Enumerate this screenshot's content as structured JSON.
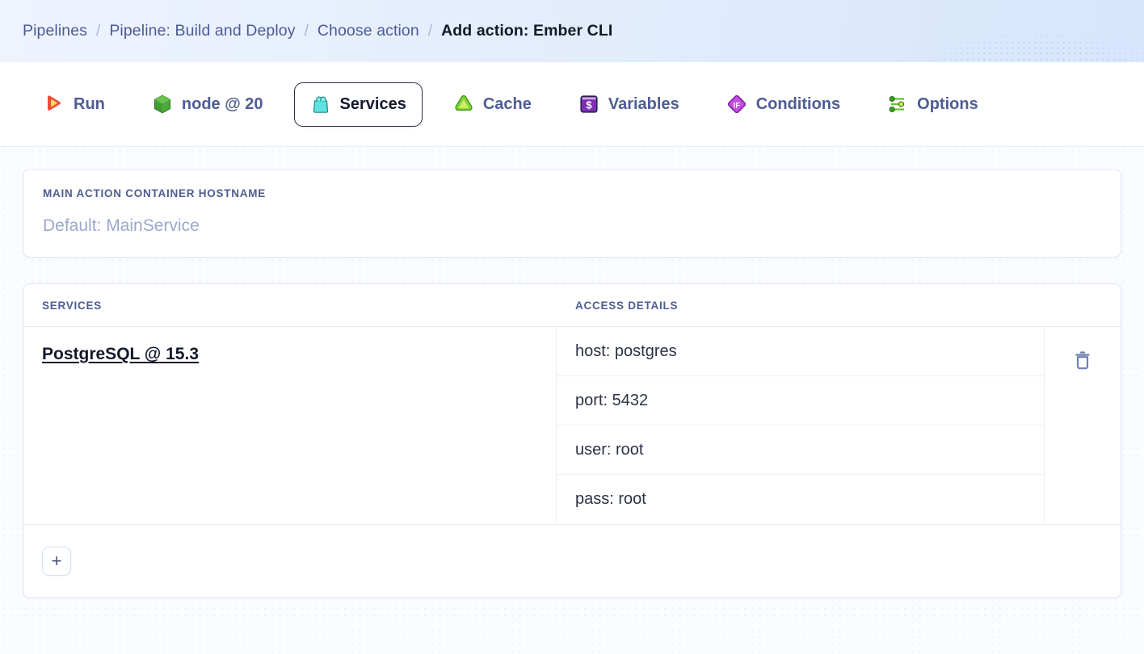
{
  "breadcrumb": {
    "separator": "/",
    "items": [
      {
        "label": "Pipelines",
        "current": false
      },
      {
        "label": "Pipeline: Build and Deploy",
        "current": false
      },
      {
        "label": "Choose action",
        "current": false
      },
      {
        "label": "Add action: Ember CLI",
        "current": true
      }
    ]
  },
  "tabs": [
    {
      "label": "Run",
      "icon": "play-icon",
      "selected": false
    },
    {
      "label": "node @ 20",
      "icon": "node-cube-icon",
      "selected": false
    },
    {
      "label": "Services",
      "icon": "services-icon",
      "selected": true
    },
    {
      "label": "Cache",
      "icon": "cache-icon",
      "selected": false
    },
    {
      "label": "Variables",
      "icon": "variables-icon",
      "selected": false
    },
    {
      "label": "Conditions",
      "icon": "conditions-icon",
      "selected": false
    },
    {
      "label": "Options",
      "icon": "options-icon",
      "selected": false
    }
  ],
  "hostname_card": {
    "label": "MAIN ACTION CONTAINER HOSTNAME",
    "value": "",
    "placeholder": "Default: MainService"
  },
  "services_table": {
    "headers": {
      "services": "SERVICES",
      "access_details": "ACCESS DETAILS"
    },
    "rows": [
      {
        "service": "PostgreSQL @ 15.3",
        "details": [
          "host: postgres",
          "port: 5432",
          "user: root",
          "pass: root"
        ],
        "delete_icon": "trash-icon"
      }
    ],
    "add_button_label": "+"
  },
  "colors": {
    "header_gradient_start": "#eef3fe",
    "header_gradient_end": "#d6e6fc",
    "crumb_link": "#4b5c97",
    "crumb_current": "#14182b",
    "tab_label": "#4e5d93",
    "tab_selected_border": "#2c3347",
    "card_border": "#dde5f4",
    "page_background": "#fbfcfe",
    "placeholder": "#9aa8cb",
    "detail_text": "#2b3245",
    "trash": "#6f7fb3",
    "accent_run": "#f04e37",
    "accent_node": "#4fa83d",
    "accent_services": "#45d8d8",
    "accent_cache": "#5cb226",
    "accent_variables": "#9b46d6",
    "accent_conditions": "#c34ee0",
    "accent_options": "#4fa83d"
  }
}
